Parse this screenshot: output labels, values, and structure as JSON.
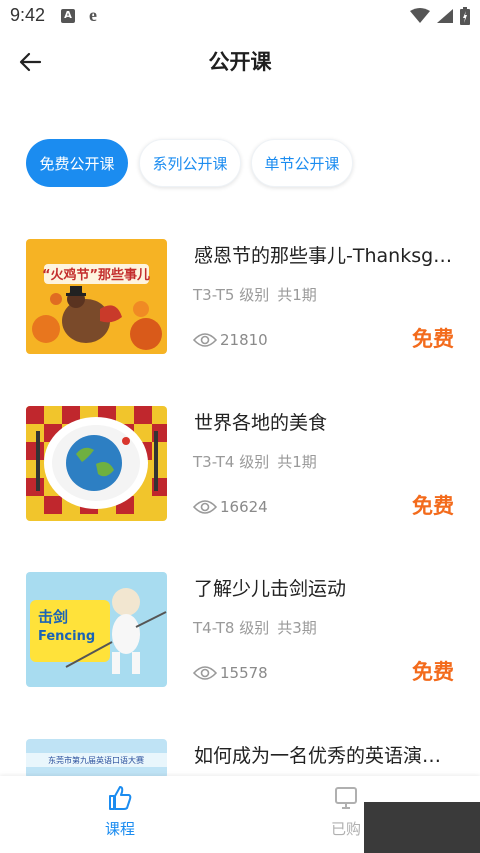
{
  "status_bar": {
    "time": "9:42",
    "a_badge": "A",
    "e_icon": "e"
  },
  "header": {
    "title": "公开课"
  },
  "chips": [
    {
      "label": "免费公开课",
      "active": true
    },
    {
      "label": "系列公开课",
      "active": false
    },
    {
      "label": "单节公开课",
      "active": false
    }
  ],
  "courses": [
    {
      "title": "感恩节的那些事儿-Thanksgiving",
      "level": "T3-T5 级别",
      "periods": "共1期",
      "views": "21810",
      "price": "免费",
      "thumb_text": "“火鸡节”那些事儿"
    },
    {
      "title": "世界各地的美食",
      "level": "T3-T4 级别",
      "periods": "共1期",
      "views": "16624",
      "price": "免费",
      "thumb_text": ""
    },
    {
      "title": "了解少儿击剑运动",
      "level": "T4-T8 级别",
      "periods": "共3期",
      "views": "15578",
      "price": "免费",
      "thumb_text": "击剑",
      "thumb_subtext": "Fencing"
    },
    {
      "title": "如何成为一名优秀的英语演讲者",
      "level": "",
      "periods": "",
      "views": "",
      "price": "",
      "thumb_text": "东莞市第九届英语口语大赛"
    }
  ],
  "bottom_nav": [
    {
      "label": "课程",
      "icon": "thumbs-up-icon",
      "active": true
    },
    {
      "label": "已购",
      "icon": "monitor-icon",
      "active": false
    }
  ],
  "colors": {
    "accent": "#1b8cf0",
    "price": "#f36b1c",
    "title": "#1f1f1f",
    "meta": "#9a9a9a"
  }
}
